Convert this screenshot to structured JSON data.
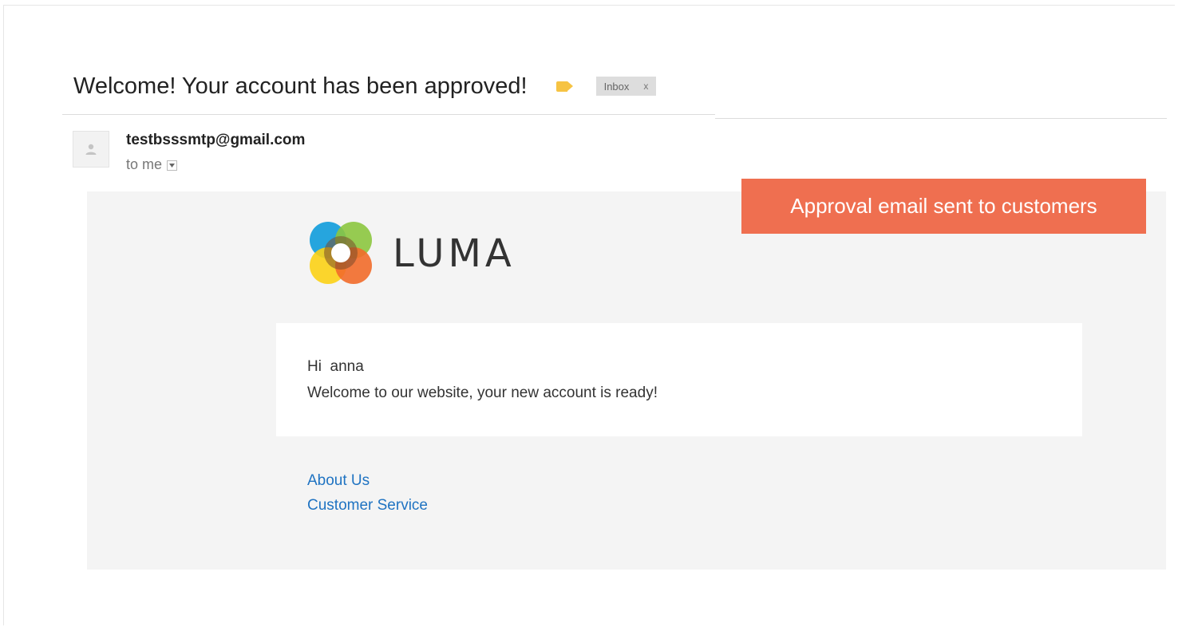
{
  "email": {
    "subject": "Welcome! Your account has been approved!",
    "label_chip": {
      "text": "Inbox",
      "remove": "x"
    },
    "sender": "testbsssmtp@gmail.com",
    "recipient": "to me"
  },
  "callout": {
    "text": "Approval email sent to customers"
  },
  "body": {
    "brand": "LUMA",
    "greeting": "Hi  anna",
    "message": "Welcome to our website, your new account is ready!",
    "links": [
      {
        "label": "About Us"
      },
      {
        "label": "Customer Service"
      }
    ]
  },
  "colors": {
    "callout_bg": "#ef6f50",
    "link": "#1f73c2",
    "label_tag": "#f6c343",
    "body_bg": "#f4f4f4"
  }
}
